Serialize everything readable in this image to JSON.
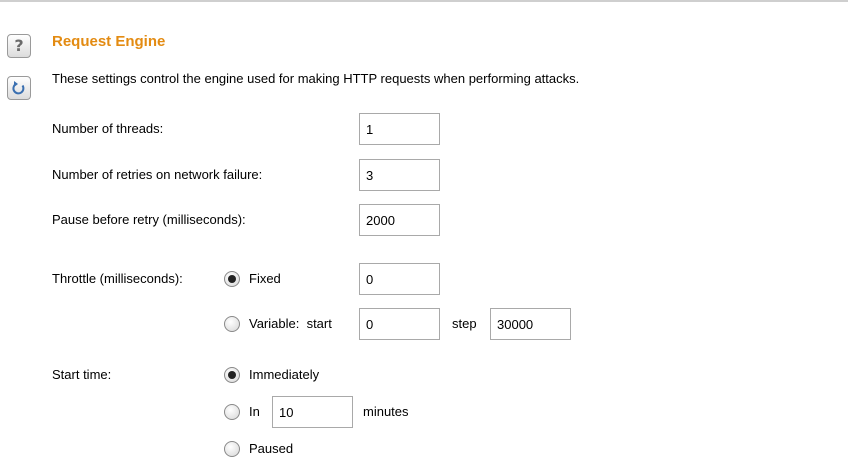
{
  "section": {
    "title": "Request Engine",
    "description": "These settings control the engine used for making HTTP requests when performing attacks."
  },
  "icons": {
    "help": "help-icon",
    "restore": "restore-defaults-icon"
  },
  "threads": {
    "label": "Number of threads:",
    "value": "1"
  },
  "retries": {
    "label": "Number of retries on network failure:",
    "value": "3"
  },
  "pause": {
    "label": "Pause before retry (milliseconds):",
    "value": "2000"
  },
  "throttle": {
    "label": "Throttle (milliseconds):",
    "fixed_label": "Fixed",
    "fixed_value": "0",
    "variable_label": "Variable:  start",
    "variable_start": "0",
    "step_label": "step",
    "variable_step": "30000",
    "selected": "fixed"
  },
  "start_time": {
    "label": "Start time:",
    "immediately_label": "Immediately",
    "in_label": "In",
    "in_value": "10",
    "minutes_label": "minutes",
    "paused_label": "Paused",
    "selected": "immediately"
  },
  "colors": {
    "title": "#e38b12",
    "border": "#a9a9a9"
  }
}
